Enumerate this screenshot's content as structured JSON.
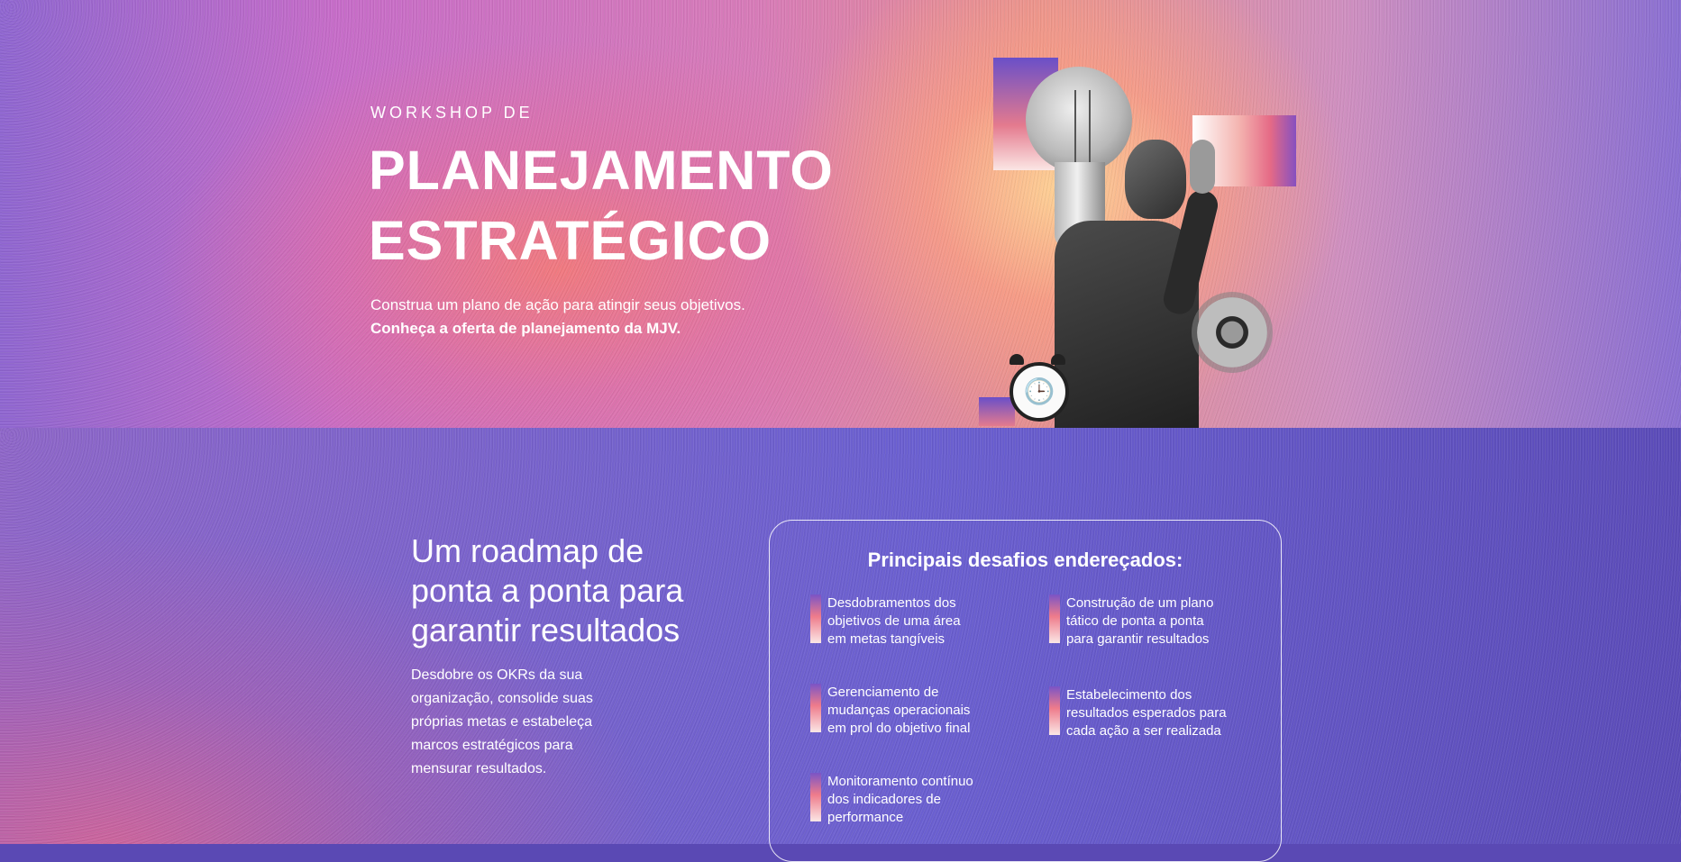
{
  "hero": {
    "eyebrow": "WORKSHOP DE",
    "headline_lines": [
      "PLANEJAMENTO",
      "ESTRATÉGICO"
    ],
    "lead": "Construa um plano de ação para atingir seus objetivos.",
    "lead_strong": "Conheça a oferta de planejamento da MJV."
  },
  "section": {
    "title_lines": [
      "Um roadmap de",
      "ponta a ponta para",
      "garantir resultados"
    ],
    "body_lines": [
      "Desdobre os OKRs da sua",
      "organização, consolide suas",
      "próprias metas e estabeleça",
      "marcos estratégicos para",
      "mensurar resultados."
    ]
  },
  "card": {
    "title": "Principais desafios endereçados:",
    "items": [
      {
        "lines": [
          "Desdobramentos dos",
          "objetivos de uma área",
          "em metas tangíveis"
        ]
      },
      {
        "lines": [
          "Construção de um plano",
          "tático de ponta a ponta",
          "para garantir resultados"
        ]
      },
      {
        "lines": [
          "Gerenciamento de",
          "mudanças operacionais",
          "em prol do objetivo final"
        ]
      },
      {
        "lines": [
          "Estabelecimento dos",
          "resultados esperados para",
          "cada ação a ser realizada"
        ]
      },
      {
        "lines": [
          "Monitoramento contínuo",
          "dos indicadores de",
          "performance"
        ]
      }
    ]
  },
  "colors": {
    "hero_pink": "#e59090",
    "hero_purple": "#8f66d0",
    "section_purple": "#6a5fd0",
    "accent_gradient_top": "#7a54c6",
    "accent_gradient_mid": "#ee7b8b"
  },
  "icons": [
    "lightbulb-illustration",
    "gear-icon",
    "alarm-clock-icon"
  ]
}
